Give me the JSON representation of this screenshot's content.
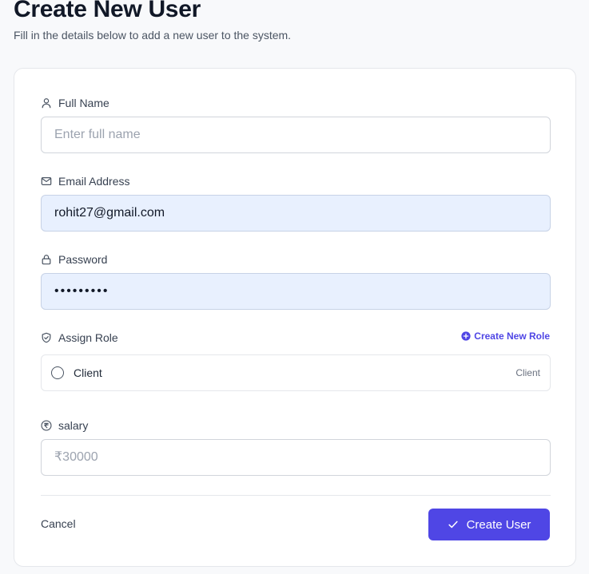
{
  "header": {
    "title": "Create New User",
    "subtitle": "Fill in the details below to add a new user to the system."
  },
  "form": {
    "full_name": {
      "icon": "user-icon",
      "label": "Full Name",
      "value": "",
      "placeholder": "Enter full name"
    },
    "email": {
      "icon": "mail-icon",
      "label": "Email Address",
      "value": "rohit27@gmail.com",
      "placeholder": ""
    },
    "password": {
      "icon": "lock-icon",
      "label": "Password",
      "value": "•••••••••"
    },
    "role": {
      "icon": "shield-icon",
      "label": "Assign Role",
      "create_link": "Create New Role",
      "options": [
        {
          "name": "Client",
          "tag": "Client",
          "selected": false
        }
      ]
    },
    "salary": {
      "icon": "rupee-icon",
      "label": "salary",
      "value": "",
      "placeholder": "₹30000"
    }
  },
  "actions": {
    "cancel_label": "Cancel",
    "submit_label": "Create User"
  },
  "colors": {
    "accent": "#4f46e5",
    "filled_input_bg": "#e8f0fe",
    "page_bg": "#f8f9fb"
  }
}
